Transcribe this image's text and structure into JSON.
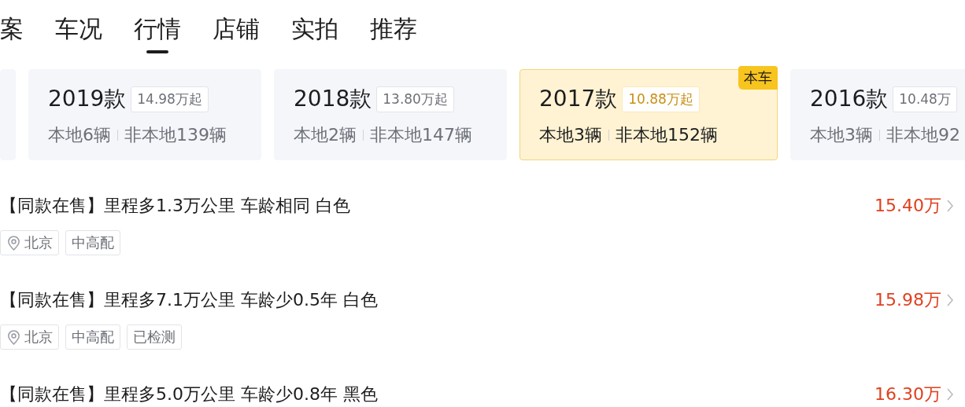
{
  "tabs": [
    {
      "label": "案",
      "selected": false
    },
    {
      "label": "车况",
      "selected": false
    },
    {
      "label": "行情",
      "selected": true
    },
    {
      "label": "店铺",
      "selected": false
    },
    {
      "label": "实拍",
      "selected": false
    },
    {
      "label": "推荐",
      "selected": false
    }
  ],
  "year_cards": [
    {
      "kind": "partial",
      "selected": false
    },
    {
      "kind": "full",
      "year": "2019款",
      "price": "14.98万起",
      "local": "本地6辆",
      "nonlocal": "非本地139辆",
      "selected": false
    },
    {
      "kind": "full",
      "year": "2018款",
      "price": "13.80万起",
      "local": "本地2辆",
      "nonlocal": "非本地147辆",
      "selected": false
    },
    {
      "kind": "full",
      "year": "2017款",
      "price": "10.88万起",
      "local": "本地3辆",
      "nonlocal": "非本地152辆",
      "selected": true,
      "badge": "本车"
    },
    {
      "kind": "full",
      "year": "2016款",
      "price": "10.48万",
      "local": "本地3辆",
      "nonlocal": "非本地92",
      "selected": false
    }
  ],
  "listings": [
    {
      "title": "【同款在售】里程多1.3万公里 车龄相同 白色",
      "price": "15.40万",
      "tags": [
        {
          "kind": "location",
          "text": "北京"
        },
        {
          "kind": "plain",
          "text": "中高配"
        }
      ]
    },
    {
      "title": "【同款在售】里程多7.1万公里 车龄少0.5年 白色",
      "price": "15.98万",
      "tags": [
        {
          "kind": "location",
          "text": "北京"
        },
        {
          "kind": "plain",
          "text": "中高配"
        },
        {
          "kind": "plain",
          "text": "已检测"
        }
      ]
    },
    {
      "title": "【同款在售】里程多5.0万公里 车龄少0.8年 黑色",
      "price": "16.30万"
    }
  ]
}
